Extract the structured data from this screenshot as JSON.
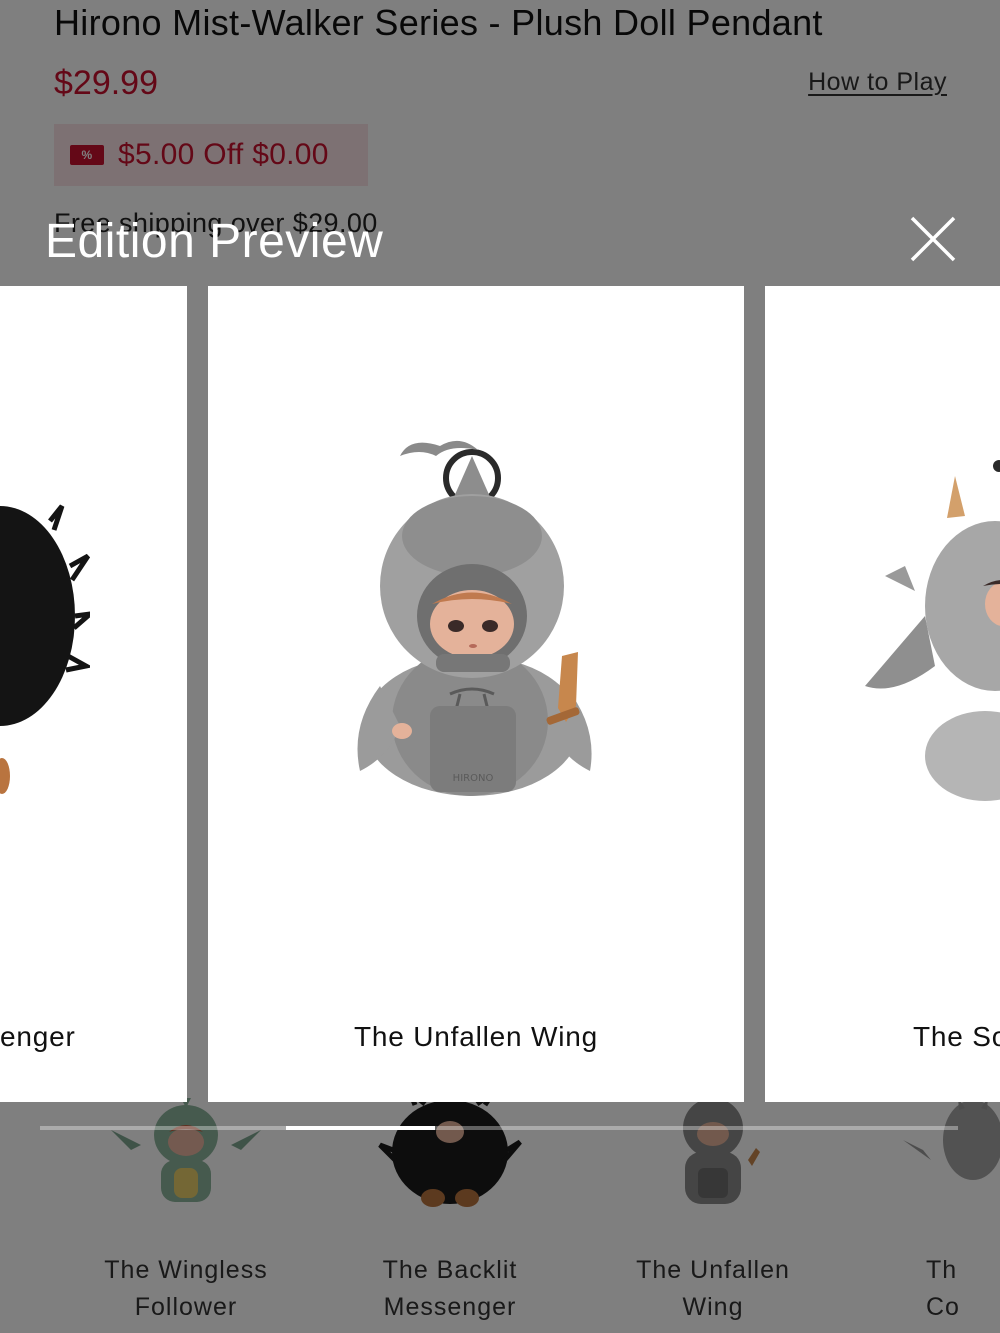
{
  "product": {
    "title": "Hirono Mist-Walker Series - Plush Doll Pendant",
    "price": "$29.99",
    "how_to_play": "How to Play",
    "coupon": {
      "icon": "%",
      "text": "$5.00 Off $0.00"
    },
    "free_shipping": "Free shipping over $29.00",
    "thumbnails": [
      {
        "label": "The Wingless\nFollower"
      },
      {
        "label": "The Backlit\nMessenger"
      },
      {
        "label": "The Unfallen\nWing"
      },
      {
        "label": "Th\nCo"
      }
    ]
  },
  "modal": {
    "title": "Edition Preview",
    "close_icon": "close-icon",
    "slides": [
      {
        "label": "enger",
        "position": "previous"
      },
      {
        "label": "The Unfallen Wing",
        "position": "current"
      },
      {
        "label": "The So",
        "position": "next"
      }
    ],
    "progress": {
      "start": 0.268,
      "end": 0.43
    }
  },
  "colors": {
    "accent": "#c8102e",
    "overlay": "rgba(0,0,0,0.5)",
    "coupon_bg": "#fbe3e6"
  }
}
